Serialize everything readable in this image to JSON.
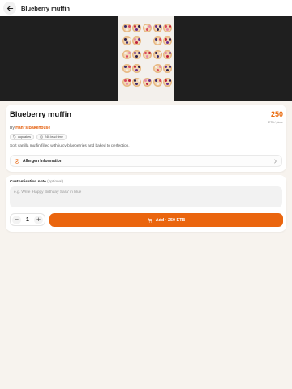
{
  "header": {
    "title": "Blueberry muffin",
    "back_icon": "arrow-left-icon"
  },
  "product": {
    "name": "Blueberry muffin",
    "price": "250",
    "price_unit": "ETB / piece",
    "by_prefix": "By",
    "shop_name": "Hani's Bakehouse",
    "tags": [
      {
        "icon": "tag-icon",
        "label": "cupcakes"
      },
      {
        "icon": "clock-icon",
        "label": "24h lead time"
      }
    ],
    "description": "Soft vanilla muffin filled with juicy blueberries and baked to perfection.",
    "allergen": {
      "label": "Allergen Information",
      "icon": "alert-circle-icon"
    }
  },
  "note": {
    "label": "Customisation note",
    "optional": "(optional)",
    "placeholder": "e.g. Write 'Happy Birthday Sara' in blue",
    "value": ""
  },
  "order": {
    "decrement": "−",
    "quantity": "1",
    "increment": "+",
    "add_label": "Add · 250 ETB",
    "cart_icon": "cart-icon"
  },
  "colors": {
    "accent": "#ea650e",
    "shop_link": "#e45d0a",
    "page_bg": "#f7f3ee",
    "hero_bg": "#1f1f1f"
  }
}
